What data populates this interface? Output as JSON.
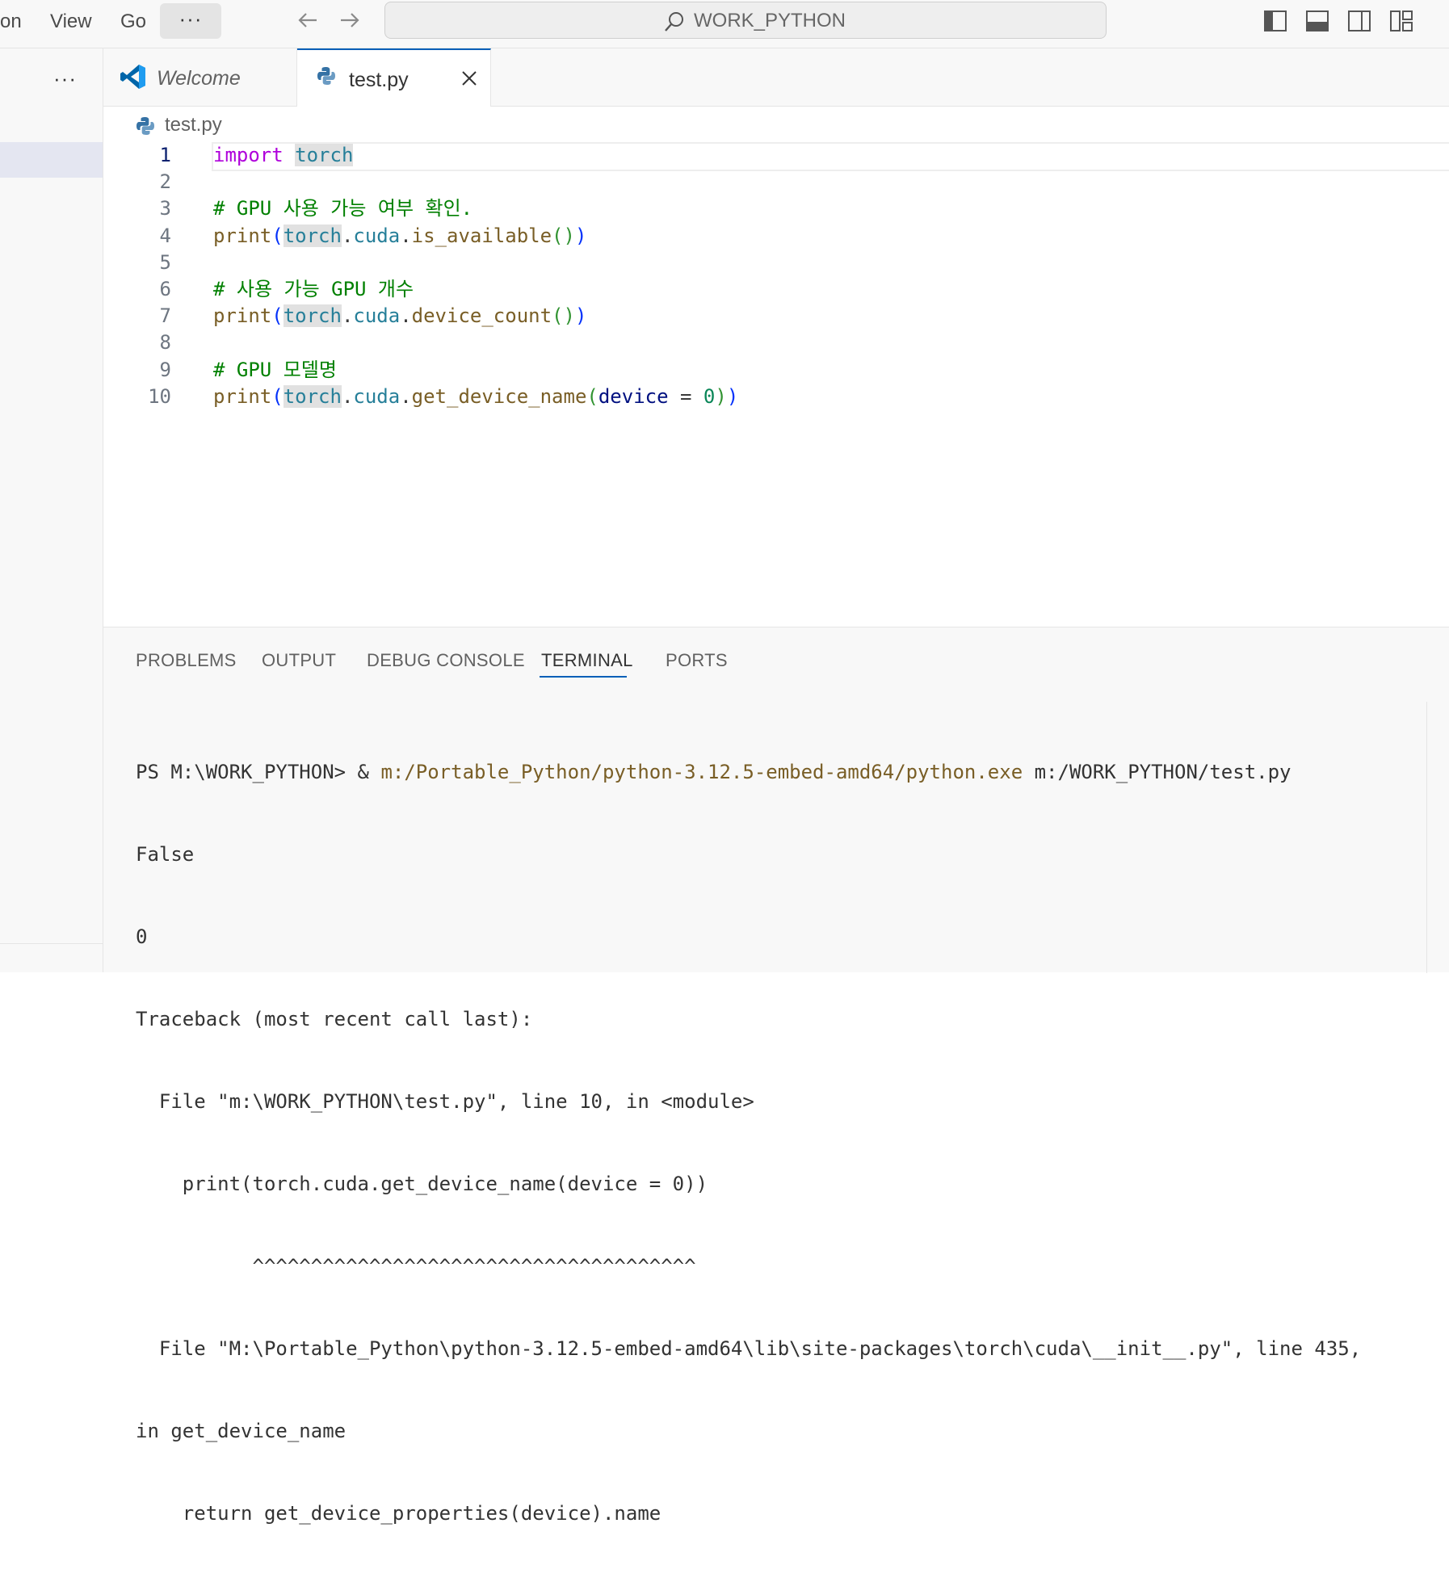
{
  "menu": {
    "items": [
      "on",
      "View",
      "Go"
    ],
    "more_label": "···"
  },
  "command_center": {
    "label": "WORK_PYTHON"
  },
  "sidebar": {
    "more_label": "···"
  },
  "tabs": [
    {
      "label": "Welcome",
      "active": false,
      "icon": "vscode-icon"
    },
    {
      "label": "test.py",
      "active": true,
      "icon": "python-file-icon"
    }
  ],
  "breadcrumb": {
    "file": "test.py"
  },
  "editor": {
    "language": "python",
    "active_line": 1,
    "lines": [
      {
        "number": "1",
        "text": "import torch"
      },
      {
        "number": "2",
        "text": ""
      },
      {
        "number": "3",
        "text": "# GPU 사용 가능 여부 확인."
      },
      {
        "number": "4",
        "text": "print(torch.cuda.is_available())"
      },
      {
        "number": "5",
        "text": ""
      },
      {
        "number": "6",
        "text": "# 사용 가능 GPU 개수"
      },
      {
        "number": "7",
        "text": "print(torch.cuda.device_count())"
      },
      {
        "number": "8",
        "text": ""
      },
      {
        "number": "9",
        "text": "# GPU 모델명"
      },
      {
        "number": "10",
        "text": "print(torch.cuda.get_device_name(device = 0))"
      }
    ]
  },
  "panel": {
    "tabs": [
      "PROBLEMS",
      "OUTPUT",
      "DEBUG CONSOLE",
      "TERMINAL",
      "PORTS"
    ],
    "active_tab": "TERMINAL",
    "terminal": {
      "prompt": "PS M:\\WORK_PYTHON> & ",
      "exe": "m:/Portable_Python/python-3.12.5-embed-amd64/python.exe",
      "args": " m:/WORK_PYTHON/test.py",
      "output": [
        "False",
        "0",
        "Traceback (most recent call last):",
        "  File \"m:\\WORK_PYTHON\\test.py\", line 10, in <module>",
        "    print(torch.cuda.get_device_name(device = 0))",
        "          ^^^^^^^^^^^^^^^^^^^^^^^^^^^^^^^^^^^^^^",
        "  File \"M:\\Portable_Python\\python-3.12.5-embed-amd64\\lib\\site-packages\\torch\\cuda\\__init__.py\", line 435,",
        "in get_device_name",
        "    return get_device_properties(device).name"
      ]
    }
  },
  "colors": {
    "accent": "#005fb8",
    "keyword": "#af00db",
    "function": "#795e26",
    "type": "#267f99",
    "comment": "#008000",
    "number": "#098658"
  }
}
